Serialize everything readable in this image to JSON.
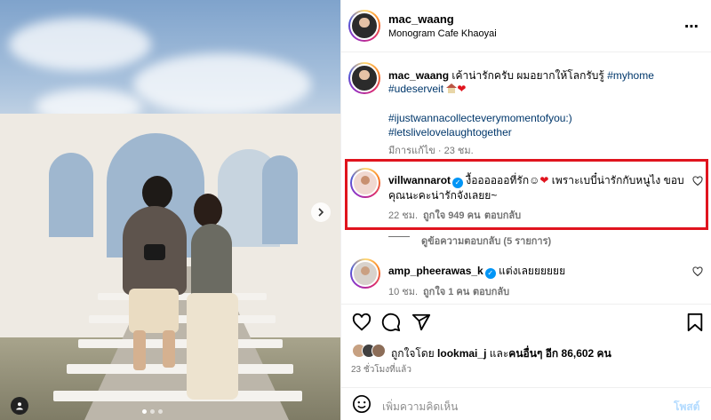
{
  "post": {
    "username": "mac_waang",
    "location": "Monogram Cafe Khaoyai",
    "more_label": "⋯"
  },
  "caption": {
    "username": "mac_waang",
    "text": "เค้าน่ารักครับ ผมอยากให้โลกรับรู้",
    "tag1": "#myhome",
    "tag2": "#udeserveit",
    "tag3": "#ijustwannacollecteverymomentofyou:)",
    "tag4": "#letslivelovelaughtogether",
    "edited": "มีการแก้ไข · 23 ชม."
  },
  "comments": [
    {
      "username": "villwannarot",
      "verified": true,
      "text_line1": "งื้ออออออที่รัก",
      "text_line1b": "เพราะเบบี๋น่ารักกับหนูไง ขอบ",
      "text_line2": "คุณนะคะน่ารักจังเลยย~",
      "time": "22 ชม.",
      "likes": "ถูกใจ 949 คน",
      "reply": "ตอบกลับ",
      "view_replies": "ดูข้อความตอบกลับ (5 รายการ)"
    },
    {
      "username": "amp_pheerawas_k",
      "verified": true,
      "text": "แต่งเลยยยยยย",
      "time": "10 ชม.",
      "likes": "ถูกใจ 1 คน",
      "reply": "ตอบกลับ"
    }
  ],
  "likes": {
    "prefix": "ถูกใจโดย",
    "user": "lookmai_j",
    "mid": "และ",
    "others": "คนอื่นๆ อีก 86,602 คน"
  },
  "posted_ago": "23 ชั่วโมงที่แล้ว",
  "comment_box": {
    "placeholder": "เพิ่มความคิดเห็น",
    "post_label": "โพสต์"
  },
  "icons": {
    "like": "heart-icon",
    "comment": "comment-icon",
    "share": "send-icon",
    "save": "bookmark-icon",
    "emoji": "emoji-icon",
    "next": "chevron-right-icon",
    "user_tag": "user-tag-icon"
  },
  "colors": {
    "highlight": "#e0141e",
    "hashtag": "#00376b",
    "verified": "#0095f6",
    "post_button": "#b3dbff"
  }
}
